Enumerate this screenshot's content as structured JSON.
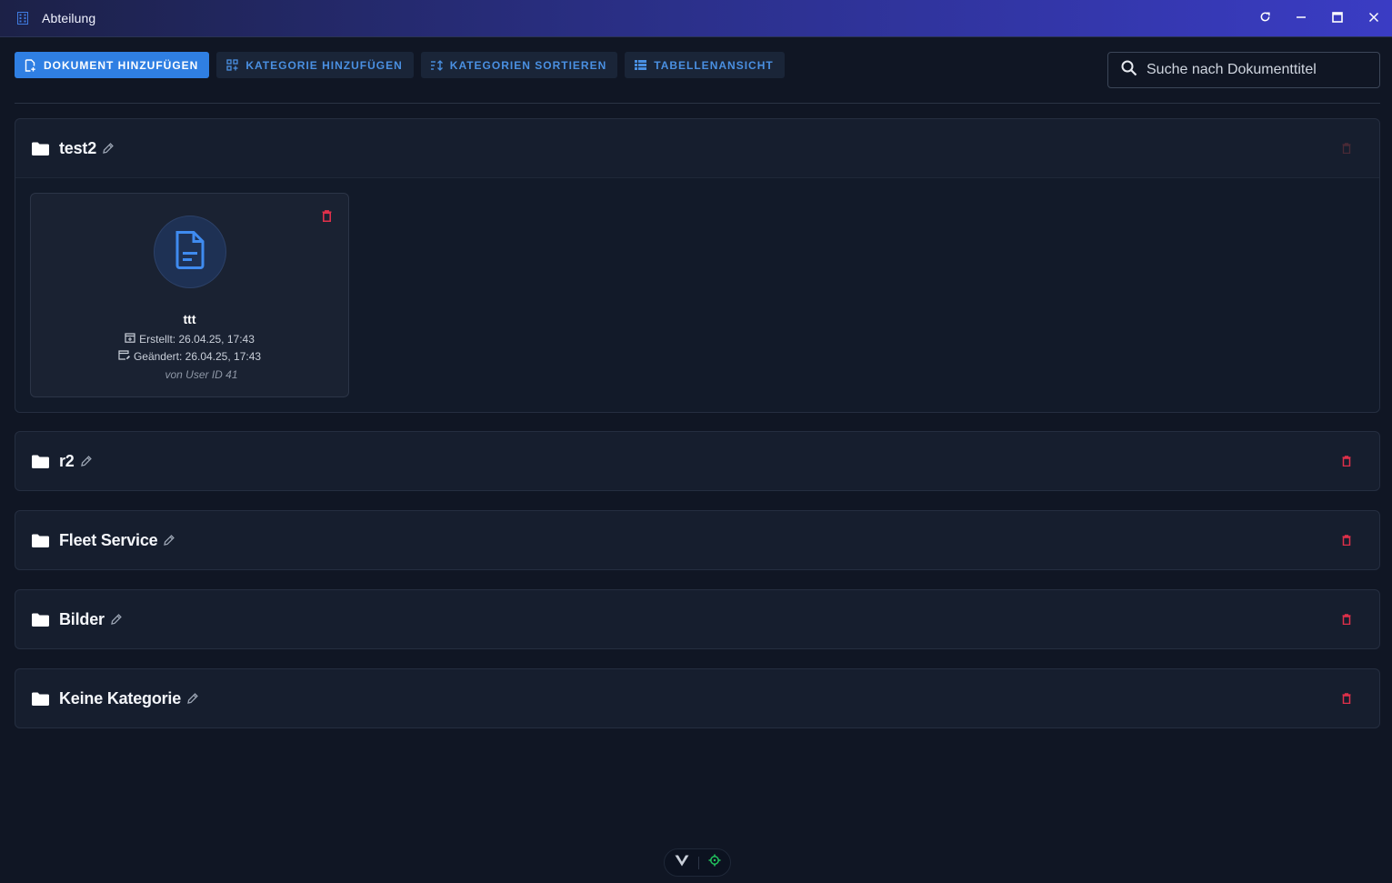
{
  "window": {
    "title": "Abteilung",
    "controls": [
      "refresh-icon",
      "minimize-icon",
      "maximize-icon",
      "close-icon"
    ]
  },
  "toolbar": {
    "add_document": "DOKUMENT HINZUFÜGEN",
    "add_category": "KATEGORIE HINZUFÜGEN",
    "sort_categories": "KATEGORIEN SORTIEREN",
    "table_view": "TABELLENANSICHT"
  },
  "search": {
    "placeholder": "Suche nach Dokumenttitel",
    "value": ""
  },
  "categories": [
    {
      "name": "test2",
      "expanded": true,
      "documents": [
        {
          "title": "ttt",
          "created": "Erstellt: 26.04.25, 17:43",
          "modified": "Geändert: 26.04.25, 17:43",
          "author": "von User ID 41"
        }
      ]
    },
    {
      "name": "r2",
      "expanded": false
    },
    {
      "name": "Fleet Service",
      "expanded": false
    },
    {
      "name": "Bilder",
      "expanded": false
    },
    {
      "name": "Keine Kategorie",
      "expanded": false
    }
  ],
  "colors": {
    "accent": "#2f7fe3",
    "danger": "#e0304a",
    "background": "#101624",
    "panel": "#161e2e"
  }
}
